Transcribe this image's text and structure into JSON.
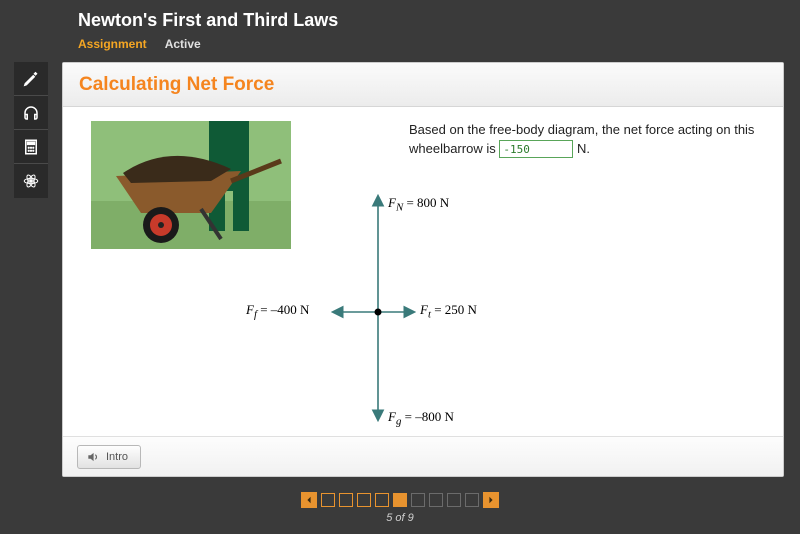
{
  "header": {
    "title": "Newton's First and Third Laws",
    "tab_assignment": "Assignment",
    "tab_active": "Active"
  },
  "sidebar": {
    "tools": [
      "pencil",
      "headphones",
      "calculator",
      "atom"
    ]
  },
  "card": {
    "title": "Calculating Net Force",
    "question_pre": "Based on the free-body diagram, the net force acting on this wheelbarrow is ",
    "question_post": " N.",
    "answer_value": "-150",
    "fbd": {
      "Fn": "= 800 N",
      "Ff": "= –400 N",
      "Ft": "= 250 N",
      "Fg": "= –800 N",
      "Fn_sym": "F",
      "Fn_sub": "N",
      "Ff_sym": "F",
      "Ff_sub": "f",
      "Ft_sym": "F",
      "Ft_sub": "t",
      "Fg_sym": "F",
      "Fg_sub": "g"
    },
    "intro_label": "Intro"
  },
  "pager": {
    "current": 5,
    "total": 9,
    "text": "5 of 9"
  }
}
